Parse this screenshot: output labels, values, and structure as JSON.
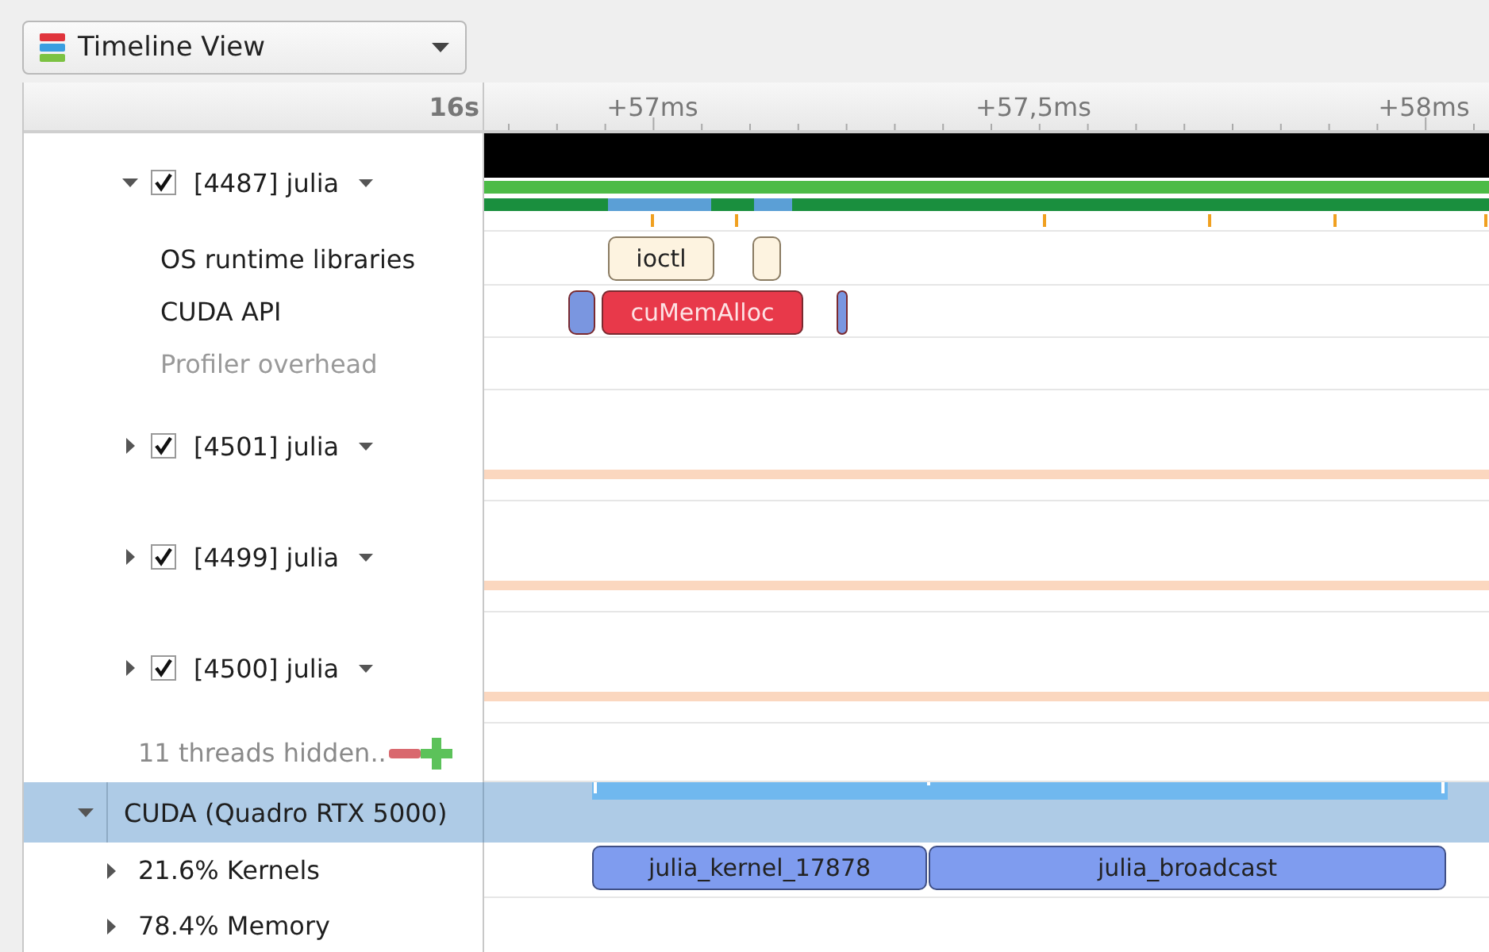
{
  "toolbar": {
    "view_selector": "Timeline View"
  },
  "timeline_header": {
    "origin": "16s",
    "ticks": [
      "+57ms",
      "+57,5ms",
      "+58ms"
    ]
  },
  "processes": [
    {
      "label": "[4487] julia",
      "checked": true,
      "expanded": true,
      "children": [
        {
          "label": "OS runtime libraries",
          "disabled": false,
          "events": [
            {
              "kind": "os-call",
              "label": "ioctl",
              "color": "#fdf3e0"
            },
            {
              "kind": "os-call",
              "color": "#fdf3e0"
            }
          ]
        },
        {
          "label": "CUDA API",
          "disabled": false,
          "events": [
            {
              "kind": "api-call",
              "color": "#7a96e0"
            },
            {
              "kind": "api-call",
              "label": "cuMemAlloc",
              "color": "#e8394a"
            },
            {
              "kind": "api-call",
              "color": "#7a96e0"
            }
          ]
        },
        {
          "label": "Profiler overhead",
          "disabled": true
        }
      ]
    },
    {
      "label": "[4501] julia",
      "checked": true,
      "expanded": false
    },
    {
      "label": "[4499] julia",
      "checked": true,
      "expanded": false
    },
    {
      "label": "[4500] julia",
      "checked": true,
      "expanded": false
    }
  ],
  "hidden_threads": {
    "label": "11 threads hidden.."
  },
  "gpu": {
    "label": "CUDA (Quadro RTX 5000)",
    "expanded": true,
    "selected": true,
    "children": [
      {
        "label": "21.6% Kernels",
        "expanded": false,
        "events": [
          {
            "kind": "kernel",
            "label": "julia_kernel_17878",
            "color": "#7f9cef"
          },
          {
            "kind": "kernel",
            "label": "julia_broadcast",
            "color": "#7f9cef"
          }
        ]
      },
      {
        "label": "78.4% Memory",
        "expanded": false
      }
    ]
  }
}
